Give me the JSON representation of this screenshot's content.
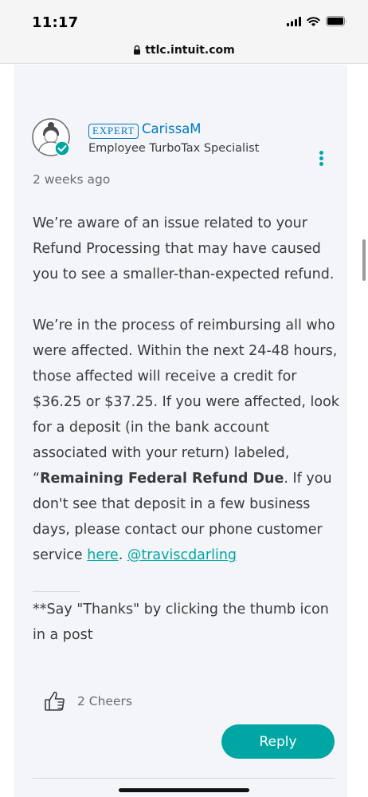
{
  "status_bar": {
    "time": "11:17"
  },
  "browser": {
    "url": "ttlc.intuit.com"
  },
  "post": {
    "badge": "EXPERT",
    "author": "CarissaM",
    "author_title": "Employee TurboTax Specialist",
    "timestamp": "2 weeks ago",
    "paragraph1": "We’re aware of an issue related to your Refund Processing that may have caused you to see a smaller-than-expected refund.",
    "paragraph2_a": "We’re in the process of reimbursing all who were affected. Within the next 24-48 hours, those affected will receive a credit for $36.25 or $37.25. If you were affected, look for a deposit (in the bank account associated with your return) labeled, “",
    "paragraph2_bold": "Remaining Federal Refund Due",
    "paragraph2_b": ".  If you don't see that deposit in a few business days, please contact our phone customer service ",
    "link_here": "here",
    "paragraph2_sep": ". ",
    "mention": "@traviscdarling",
    "signature": "**Say \"Thanks\" by clicking the thumb icon in a post",
    "cheers": "2 Cheers",
    "reply_label": "Reply"
  },
  "colors": {
    "accent": "#00a6a4",
    "brand_blue": "#0077c5",
    "card_bg": "#f4f5f8"
  }
}
